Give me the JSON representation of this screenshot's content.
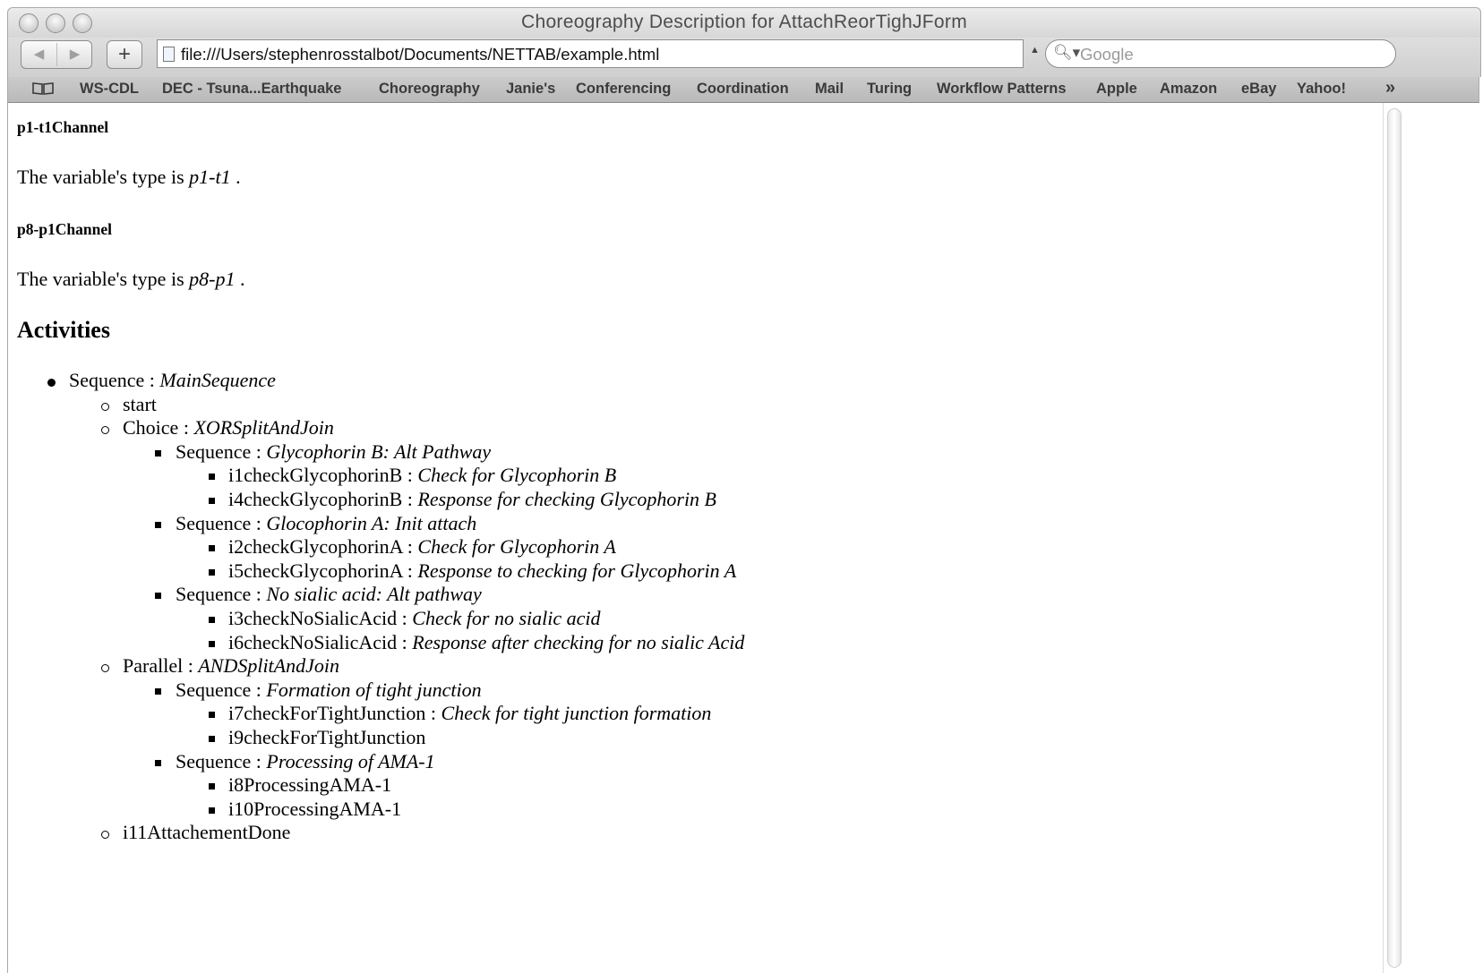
{
  "window": {
    "title": "Choreography Description for AttachReorTighJForm"
  },
  "toolbar": {
    "back_glyph": "◀",
    "forward_glyph": "▶",
    "add_glyph": "+",
    "url": "file:///Users/stephenrosstalbot/Documents/NETTAB/example.html",
    "search_placeholder": "Google"
  },
  "bookmarks": {
    "items": [
      "WS-CDL",
      "DEC - Tsuna...Earthquake",
      "Choreography",
      "Janie's",
      "Conferencing",
      "Coordination",
      "Mail",
      "Turing",
      "Workflow Patterns",
      "Apple",
      "Amazon",
      "eBay",
      "Yahoo!"
    ],
    "more_glyph": "»"
  },
  "content": {
    "sections": [
      {
        "heading": "p1-t1Channel",
        "text_prefix": "The variable's type is ",
        "type": "p1-t1",
        "text_suffix": " ."
      },
      {
        "heading": "p8-p1Channel",
        "text_prefix": "The variable's type is ",
        "type": "p8-p1",
        "text_suffix": " ."
      }
    ],
    "activities_heading": "Activities",
    "tree": [
      {
        "level": 0,
        "name": "Sequence",
        "sep": " : ",
        "desc": "MainSequence"
      },
      {
        "level": 1,
        "name": "start",
        "sep": "",
        "desc": ""
      },
      {
        "level": 1,
        "name": "Choice",
        "sep": " : ",
        "desc": "XORSplitAndJoin"
      },
      {
        "level": 2,
        "name": "Sequence",
        "sep": " : ",
        "desc": "Glycophorin B: Alt Pathway"
      },
      {
        "level": 3,
        "name": "i1checkGlycophorinB",
        "sep": " : ",
        "desc": "Check for Glycophorin B"
      },
      {
        "level": 3,
        "name": "i4checkGlycophorinB",
        "sep": " : ",
        "desc": "Response for checking Glycophorin B"
      },
      {
        "level": 2,
        "name": "Sequence",
        "sep": " : ",
        "desc": "Glocophorin A: Init attach"
      },
      {
        "level": 3,
        "name": "i2checkGlycophorinA",
        "sep": " : ",
        "desc": "Check for Glycophorin A"
      },
      {
        "level": 3,
        "name": "i5checkGlycophorinA",
        "sep": " : ",
        "desc": "Response to checking for Glycophorin A"
      },
      {
        "level": 2,
        "name": "Sequence",
        "sep": " : ",
        "desc": "No sialic acid: Alt pathway"
      },
      {
        "level": 3,
        "name": "i3checkNoSialicAcid",
        "sep": " : ",
        "desc": "Check for no sialic acid"
      },
      {
        "level": 3,
        "name": "i6checkNoSialicAcid",
        "sep": " : ",
        "desc": "Response after checking for no sialic Acid"
      },
      {
        "level": 1,
        "name": "Parallel",
        "sep": " : ",
        "desc": "ANDSplitAndJoin"
      },
      {
        "level": 2,
        "name": "Sequence",
        "sep": " : ",
        "desc": "Formation of tight junction"
      },
      {
        "level": 3,
        "name": "i7checkForTightJunction",
        "sep": " : ",
        "desc": "Check for tight junction formation"
      },
      {
        "level": 3,
        "name": "i9checkForTightJunction",
        "sep": "",
        "desc": ""
      },
      {
        "level": 2,
        "name": "Sequence",
        "sep": " : ",
        "desc": "Processing of AMA-1"
      },
      {
        "level": 3,
        "name": "i8ProcessingAMA-1",
        "sep": "",
        "desc": ""
      },
      {
        "level": 3,
        "name": "i10ProcessingAMA-1",
        "sep": "",
        "desc": ""
      },
      {
        "level": 1,
        "name": "i11AttachementDone",
        "sep": "",
        "desc": ""
      }
    ]
  }
}
